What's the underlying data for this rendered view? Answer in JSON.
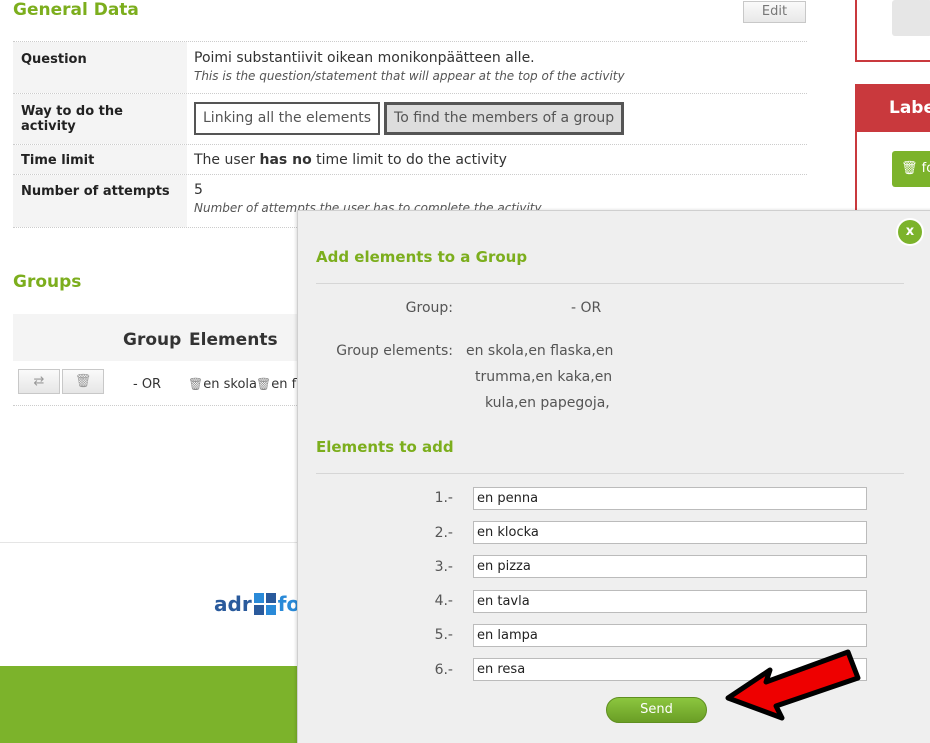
{
  "general": {
    "title": "General Data",
    "edit_label": "Edit",
    "rows": {
      "question_label": "Question",
      "question_value": "Poimi substantiivit oikean monikonpäätteen alle.",
      "question_note": "This is the question/statement that will appear at the top of the activity",
      "way_label": "Way to do the activity",
      "way_option_1": "Linking all the elements",
      "way_option_2": "To find the members of a group",
      "time_label": "Time limit",
      "time_pre": "The user ",
      "time_bold": "has no",
      "time_post": " time limit to do the activity",
      "attempts_label": "Number of attempts",
      "attempts_value": "5",
      "attempts_note": "Number of attempts the user has to complete the activity"
    }
  },
  "groups": {
    "title": "Groups",
    "col_group": "Group",
    "col_elements": "Elements",
    "row": {
      "group": "- OR",
      "element_1": "en skola",
      "element_2": "en fla"
    }
  },
  "footer": {
    "logo_text": "adr",
    "logo_tail": "fo"
  },
  "sidebar": {
    "header_text": "Labe",
    "button_text": "fo"
  },
  "modal": {
    "close_label": "x",
    "title": "Add elements to a Group",
    "group_label": "Group:",
    "group_value": "- OR",
    "elements_label": "Group elements:",
    "elements_line_1": "en skola,en flaska,en",
    "elements_line_2": "trumma,en kaka,en",
    "elements_line_3": "kula,en papegoja,",
    "add_title": "Elements to add",
    "items": [
      {
        "num": "1.-",
        "value": "en penna"
      },
      {
        "num": "2.-",
        "value": "en klocka"
      },
      {
        "num": "3.-",
        "value": "en pizza"
      },
      {
        "num": "4.-",
        "value": "en tavla"
      },
      {
        "num": "5.-",
        "value": "en lampa"
      },
      {
        "num": "6.-",
        "value": "en resa"
      }
    ],
    "send_label": "Send"
  },
  "colors": {
    "accent_green": "#7cae1d",
    "button_green": "#7cb32b",
    "sidebar_red": "#c9393d",
    "arrow_red": "#ee0000"
  }
}
